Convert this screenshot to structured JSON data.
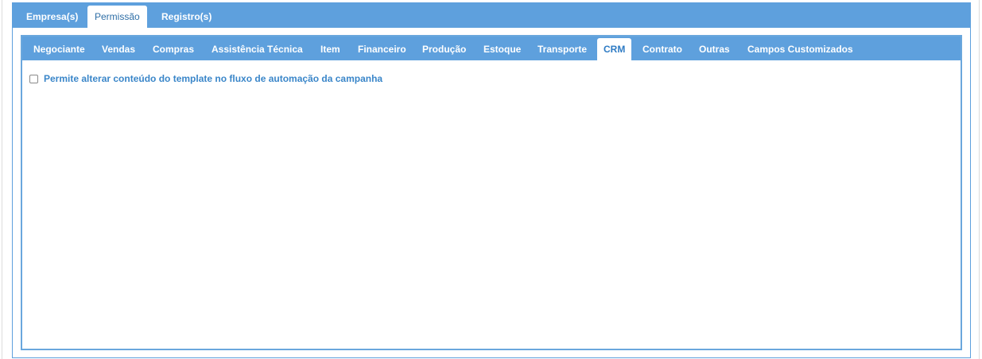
{
  "outer_tabs": [
    "Empresa(s)",
    "Permissão",
    "Registro(s)"
  ],
  "outer_active_tab": "Permissão",
  "inner_tabs": [
    "Negociante",
    "Vendas",
    "Compras",
    "Assistência Técnica",
    "Item",
    "Financeiro",
    "Produção",
    "Estoque",
    "Transporte",
    "CRM",
    "Contrato",
    "Outras",
    "Campos Customizados"
  ],
  "inner_active_tab": "CRM",
  "crm_options": [
    {
      "label": "Permite alterar conteúdo do template no fluxo de automação da campanha",
      "checked": false
    }
  ],
  "colors": {
    "tab_bar": "#5ea0dd",
    "active_tab_text": "#2e7bc4",
    "option_text": "#3a86c9"
  },
  "icons": {
    "checkbox": "checkbox-unchecked-icon"
  }
}
